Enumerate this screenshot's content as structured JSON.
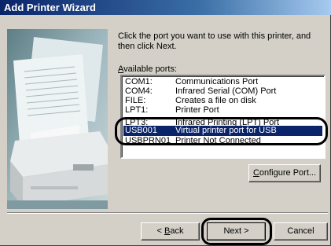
{
  "window": {
    "title": "Add Printer Wizard"
  },
  "instruction": "Click the port you want to use with this printer, and then click Next.",
  "ports_label": {
    "accel": "A",
    "rest": "vailable ports:"
  },
  "ports": [
    {
      "port": "COM1:",
      "desc": "Communications Port"
    },
    {
      "port": "COM4:",
      "desc": "Infrared Serial (COM) Port"
    },
    {
      "port": "FILE:",
      "desc": "Creates a file on disk"
    },
    {
      "port": "LPT1:",
      "desc": "Printer Port"
    },
    {
      "port": "LPT3:",
      "desc": "Infrared Printing (LPT) Port"
    },
    {
      "port": "USB001",
      "desc": "Virtual printer port for USB",
      "selected": true
    },
    {
      "port": "USBPRN01",
      "desc": "Printer Not Connected"
    }
  ],
  "buttons": {
    "configure": {
      "accel": "C",
      "rest": "onfigure Port..."
    },
    "back": {
      "prefix": "< ",
      "accel": "B",
      "rest": "ack"
    },
    "next": "Next >",
    "cancel": "Cancel"
  }
}
